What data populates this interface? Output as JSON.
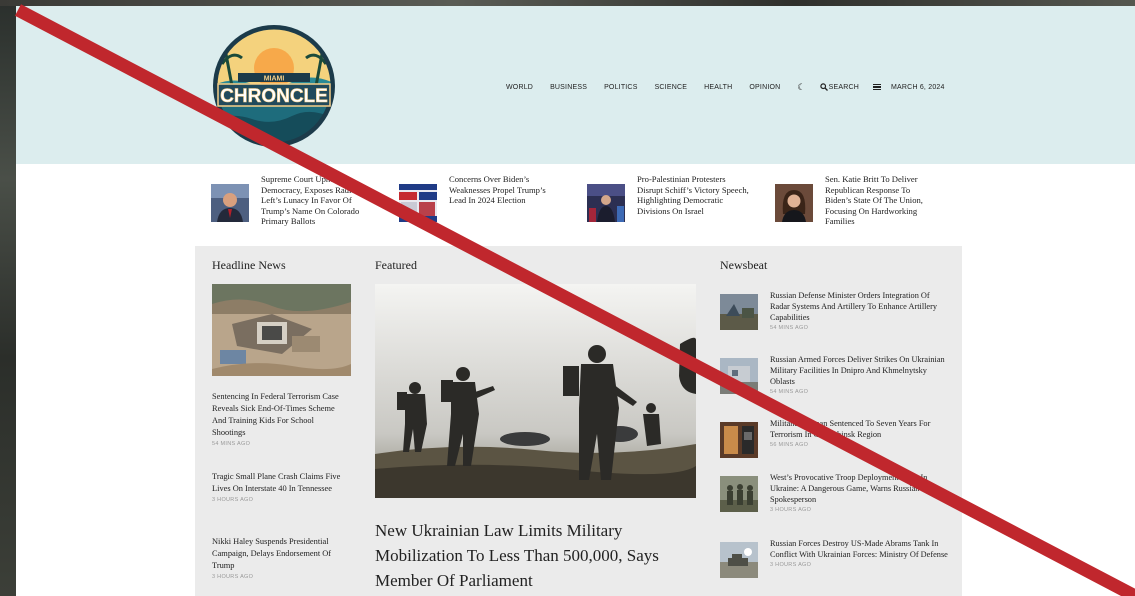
{
  "logo": {
    "line1": "MIAMI",
    "line2": "CHRONCLE"
  },
  "nav": {
    "items": [
      "WORLD",
      "BUSINESS",
      "POLITICS",
      "SCIENCE",
      "HEALTH",
      "OPINION"
    ],
    "theme_icon": "moon-icon",
    "search_label": "SEARCH",
    "menu_icon": "hamburger-menu-icon",
    "date": "MARCH 6, 2024"
  },
  "ticker": [
    {
      "title": "Supreme Court Upholds Democracy, Exposes Radical Left’s Lunacy In Favor Of Trump’s Name On Colorado Primary Ballots"
    },
    {
      "title": "Concerns Over Biden’s Weaknesses Propel Trump’s Lead In 2024 Election"
    },
    {
      "title": "Pro-Palestinian Protesters Disrupt Schiff’s Victory Speech, Highlighting Democratic Divisions On Israel"
    },
    {
      "title": "Sen. Katie Britt To Deliver Republican Response To Biden’s State Of The Union, Focusing On Hardworking Families"
    }
  ],
  "headline_news": {
    "title": "Headline News",
    "items": [
      {
        "title": "Sentencing In Federal Terrorism Case Reveals Sick End-Of-Times Scheme And Training Kids For School Shootings",
        "time": "54 MINS AGO"
      },
      {
        "title": "Tragic Small Plane Crash Claims Five Lives On Interstate 40 In Tennessee",
        "time": "3 HOURS AGO"
      },
      {
        "title": "Nikki Haley Suspends Presidential Campaign, Delays Endorsement Of Trump",
        "time": "3 HOURS AGO"
      }
    ]
  },
  "featured": {
    "title": "Featured",
    "headline": "New Ukrainian Law Limits Military Mobilization To Less Than 500,000, Says Member Of Parliament"
  },
  "newsbeat": {
    "title": "Newsbeat",
    "items": [
      {
        "title": "Russian Defense Minister Orders Integration Of Radar Systems And Artillery To Enhance Artillery Capabilities",
        "time": "54 MINS AGO"
      },
      {
        "title": "Russian Armed Forces Deliver Strikes On Ukrainian Military Facilities In Dnipro And Khmelnytsky Oblasts",
        "time": "54 MINS AGO"
      },
      {
        "title": "Militant Gunman Sentenced To Seven Years For Terrorism In Chelyabinsk Region",
        "time": "56 MINS AGO"
      },
      {
        "title": "West’s Provocative Troop Deployment Talks In Ukraine: A Dangerous Game, Warns Russian Spokesperson",
        "time": "3 HOURS AGO"
      },
      {
        "title": "Russian Forces Destroy US-Made Abrams Tank In Conflict With Ukrainian Forces: Ministry Of Defense",
        "time": "3 HOURS AGO"
      }
    ]
  },
  "colors": {
    "header_bg": "#dcedee",
    "card_bg": "#ebebeb",
    "strike": "#c0272d"
  }
}
